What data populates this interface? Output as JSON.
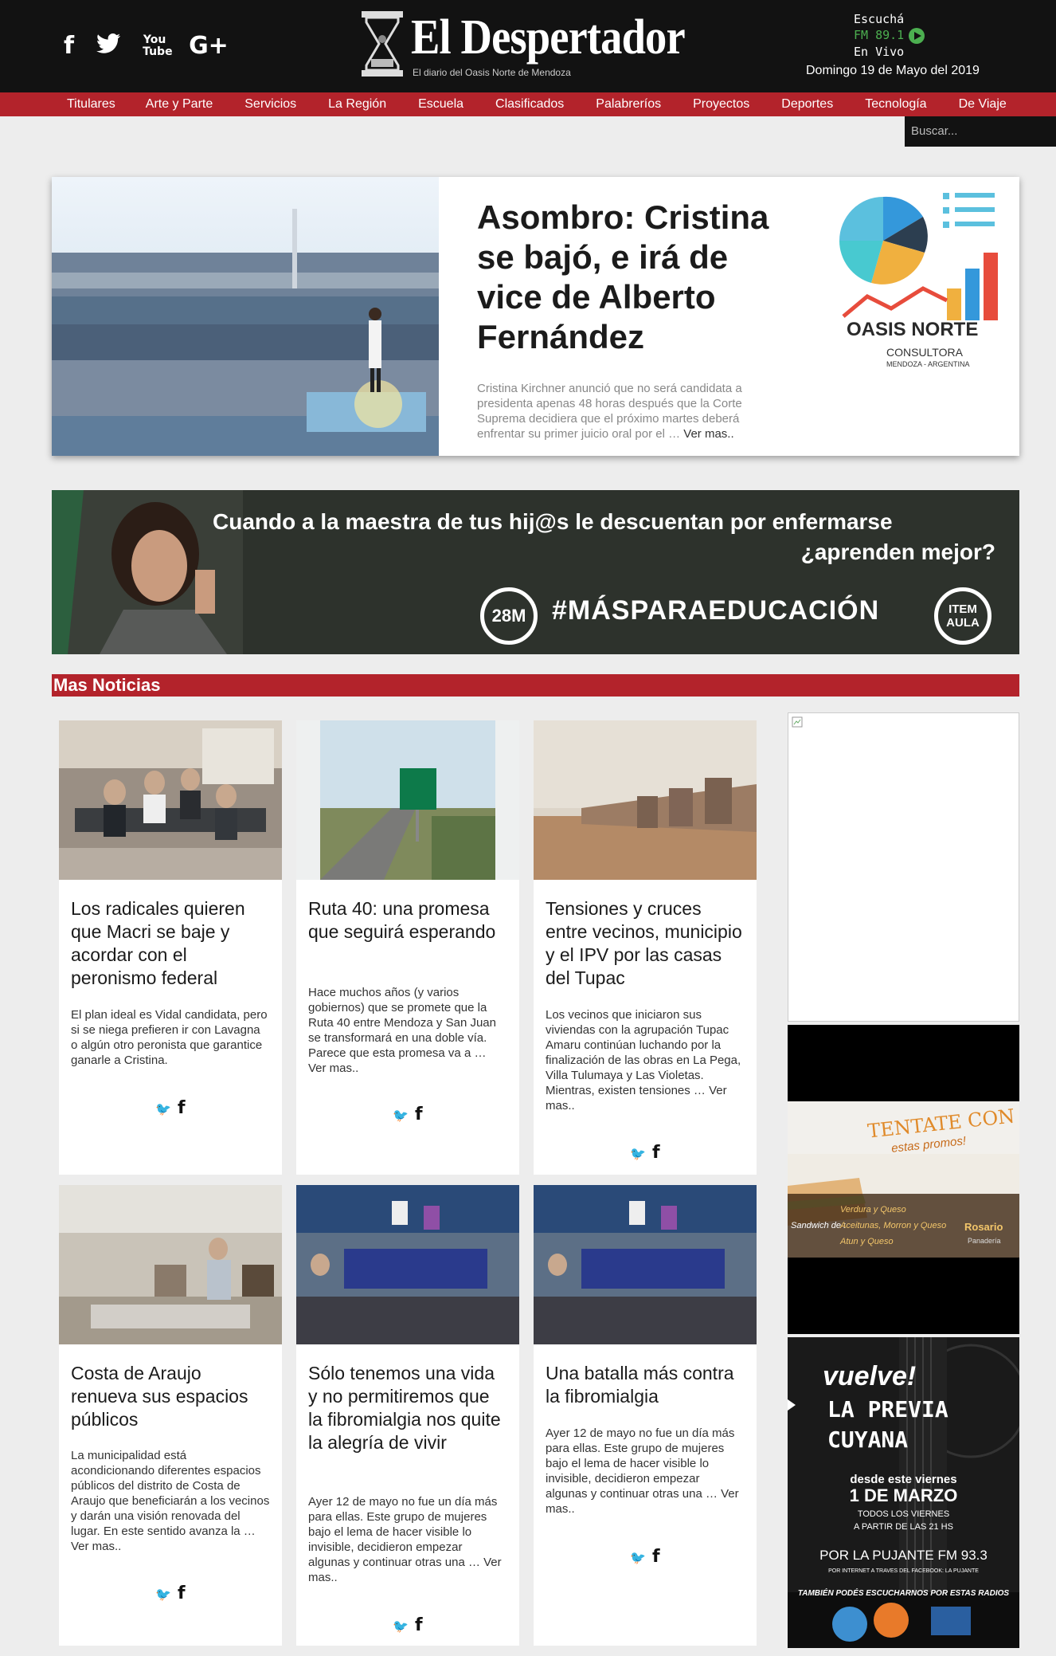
{
  "header": {
    "site_title": "El Despertador",
    "site_subtitle": "El diario del Oasis Norte de Mendoza",
    "social": [
      {
        "icon": "facebook-icon",
        "glyph": "f"
      },
      {
        "icon": "twitter-icon",
        "glyph": "🐦"
      },
      {
        "icon": "youtube-icon",
        "glyph": "You Tube"
      },
      {
        "icon": "google-plus-icon",
        "glyph": "G+"
      }
    ],
    "radio_line1": "Escuchá",
    "radio_line2": "FM 89.1",
    "radio_line3": "En Vivo",
    "date": "Domingo 19 de  Mayo del 2019",
    "accent_color": "#b3232b"
  },
  "nav": {
    "items": [
      "Titulares",
      "Arte y Parte",
      "Servicios",
      "La Región",
      "Escuela",
      "Clasificados",
      "Palabreríos",
      "Proyectos",
      "Deportes",
      "Tecnología",
      "De Viaje"
    ],
    "search_placeholder": "Buscar..."
  },
  "hero": {
    "title": "Asombro: Cristina se bajó, e irá de vice de Alberto Fernández",
    "excerpt": "Cristina Kirchner anunció que no será candidata a presidenta apenas 48 horas después que la Corte Suprema decidiera que el próximo martes deberá enfrentar su primer juicio oral por el …",
    "more": "Ver mas..",
    "ad_name": "OASIS NORTE",
    "ad_sub": "CONSULTORA",
    "ad_sub2": "MENDOZA - ARGENTINA"
  },
  "banner": {
    "line1": "Cuando a la maestra de tus hij@s le descuentan por enfermarse",
    "line2": "¿aprenden mejor?",
    "badge": "28M",
    "hashtag": "#MÁSPARAEDUCACIÓN",
    "badge2_line1": "ITEM",
    "badge2_line2": "AULA"
  },
  "section": {
    "title": "Mas Noticias"
  },
  "cards": [
    {
      "title": "Los radicales quieren que Macri se baje y acordar con el peronismo federal",
      "excerpt": "El plan ideal es Vidal candidata, pero si se niega prefieren ir con Lavagna o algún otro peronista que garantice ganarle a Cristina."
    },
    {
      "title": "Ruta 40: una promesa que seguirá esperando",
      "excerpt": "Hace muchos años (y varios gobiernos) que se promete que la Ruta 40 entre Mendoza y San Juan se transformará en una doble vía. Parece que esta promesa va a … Ver mas.."
    },
    {
      "title": "Tensiones y cruces entre vecinos, municipio y el IPV por las casas del Tupac",
      "excerpt": "Los vecinos que iniciaron sus viviendas con la agrupación Tupac Amaru continúan luchando por la finalización de las obras en La Pega, Villa Tulumaya y Las Violetas. Mientras, existen tensiones … Ver mas.."
    },
    {
      "title": "Costa de Araujo renueva sus espacios públicos",
      "excerpt": "La municipalidad está acondicionando diferentes espacios públicos del distrito de Costa de Araujo que beneficiarán a los vecinos y darán una visión renovada del lugar. En este sentido avanza la … Ver mas.."
    },
    {
      "title": "Sólo tenemos una vida y no permitiremos que la fibromialgia nos quite la alegría de vivir",
      "excerpt": "Ayer 12 de mayo no fue un día más para ellas. Este grupo de mujeres bajo el lema de hacer visible lo invisible, decidieron empezar algunas y continuar otras una … Ver mas.."
    },
    {
      "title": "Una batalla más contra la fibromialgia",
      "excerpt": "Ayer 12 de mayo no fue un día más para ellas. Este grupo de mujeres bajo el lema de hacer visible lo invisible, decidieron empezar algunas y continuar otras una … Ver mas.."
    }
  ],
  "share": {
    "twitter": "🐦",
    "facebook": "f"
  },
  "sidebar": {
    "sandwich_title": "TENTATE CON",
    "sandwich_sub": "estas promos!",
    "sandwich_label": "Sandwich de :",
    "sandwich_items": [
      "Verdura y Queso",
      "Aceitunas, Morron y Queso",
      "Atun y Queso"
    ],
    "sandwich_brand": "Rosario",
    "sandwich_brand_sub": "Panadería",
    "radio_ad": {
      "t1": "vuelve!",
      "t2a": "LA PREVIA",
      "t2b": "CUYANA",
      "t3": "desde este viernes",
      "t4": "1 DE MARZO",
      "t5a": "TODOS LOS VIERNES",
      "t5b": "A PARTIR DE LAS 21 HS",
      "t6": "POR LA PUJANTE FM 93.3",
      "t7": "POR INTERNET A TRAVES DEL FACEBOOK: LA PUJANTE",
      "t8": "TAMBIÉN PODÉS ESCUCHARNOS POR ESTAS RADIOS"
    }
  }
}
